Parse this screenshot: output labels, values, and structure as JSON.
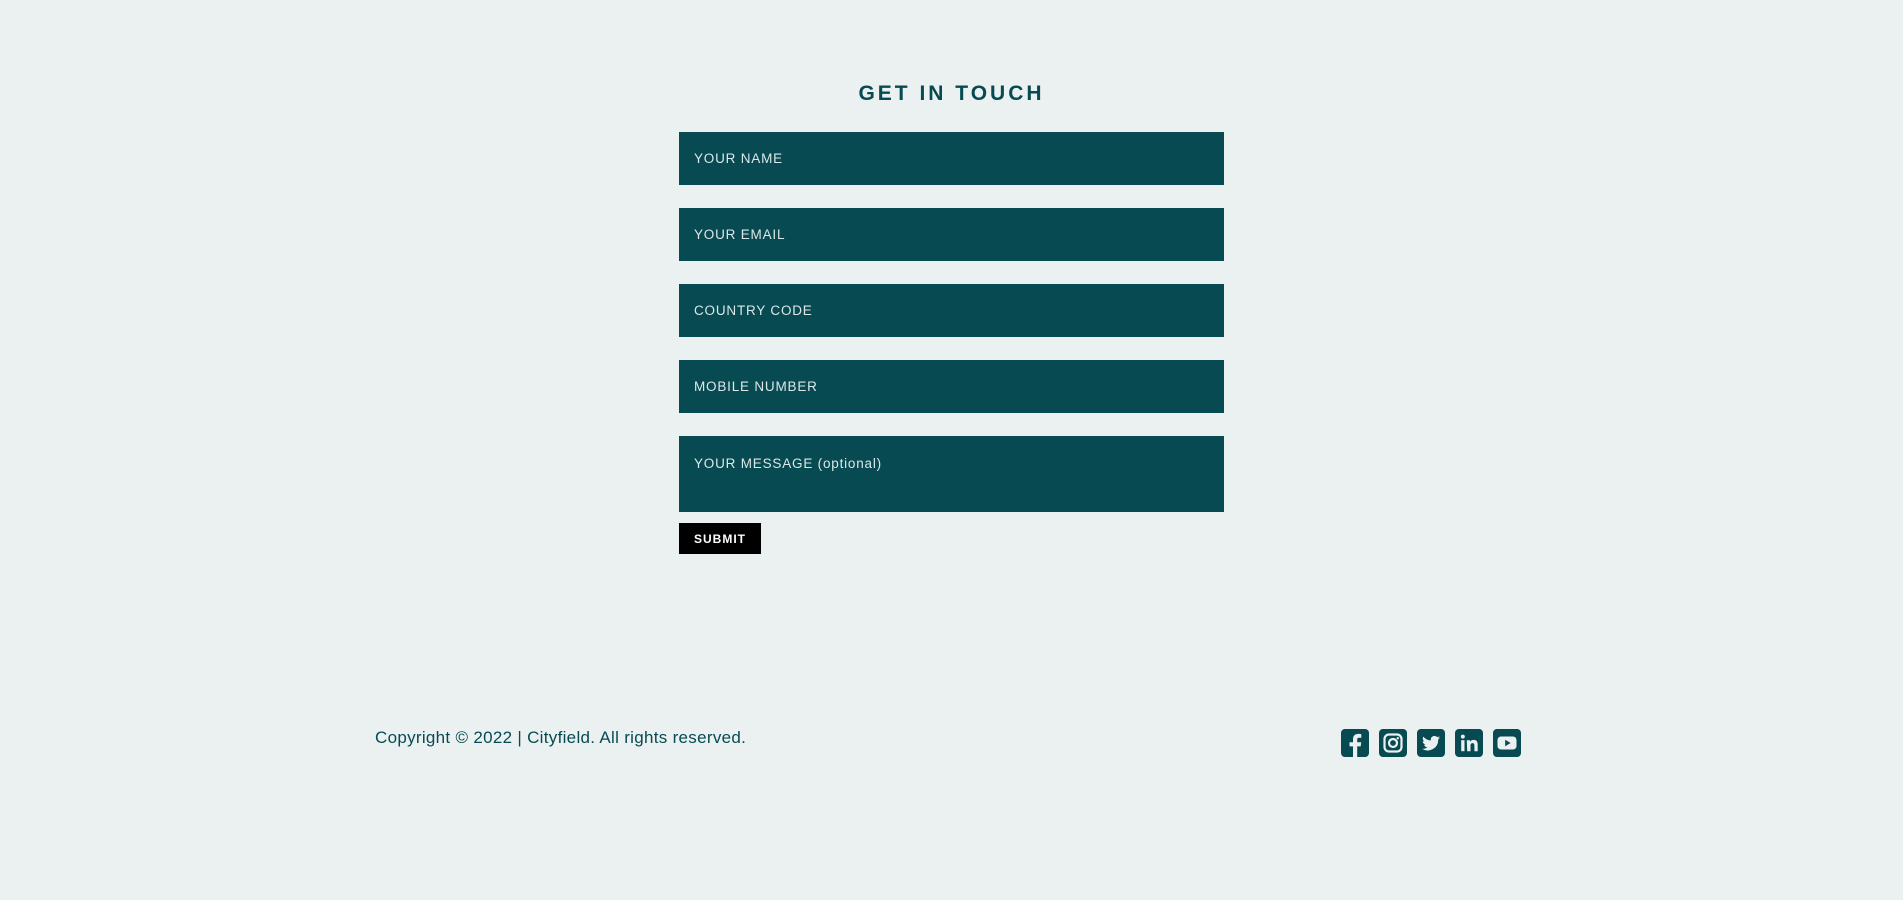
{
  "contact": {
    "title": "GET IN TOUCH",
    "fields": {
      "name_placeholder": "YOUR NAME",
      "email_placeholder": "YOUR EMAIL",
      "country_code_placeholder": "COUNTRY CODE",
      "mobile_placeholder": "MOBILE NUMBER",
      "message_placeholder": "YOUR MESSAGE (optional)"
    },
    "submit_label": "SUBMIT"
  },
  "footer": {
    "copyright": "Copyright © 2022 | Cityfield. All rights reserved.",
    "social_icons": [
      "facebook-icon",
      "instagram-icon",
      "twitter-icon",
      "linkedin-icon",
      "youtube-icon"
    ]
  },
  "colors": {
    "background": "#ebf1f1",
    "accent": "#074a52",
    "button": "#000000",
    "field_text": "#e8f0f0"
  }
}
